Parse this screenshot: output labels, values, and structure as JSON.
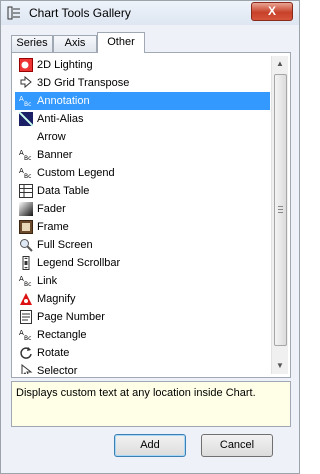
{
  "window": {
    "title": "Chart Tools Gallery",
    "close_label": "X"
  },
  "tabs": [
    {
      "label": "Series",
      "active": false
    },
    {
      "label": "Axis",
      "active": false
    },
    {
      "label": "Other",
      "active": true
    }
  ],
  "tools": [
    {
      "label": "2D Lighting",
      "icon": "2d-lighting-icon",
      "selected": false
    },
    {
      "label": "3D Grid Transpose",
      "icon": "3d-grid-transpose-icon",
      "selected": false
    },
    {
      "label": "Annotation",
      "icon": "text-abc-icon",
      "selected": true
    },
    {
      "label": "Anti-Alias",
      "icon": "anti-alias-icon",
      "selected": false
    },
    {
      "label": "Arrow",
      "icon": "arrow-icon",
      "selected": false
    },
    {
      "label": "Banner",
      "icon": "text-abc-icon",
      "selected": false
    },
    {
      "label": "Custom Legend",
      "icon": "text-abc-icon",
      "selected": false
    },
    {
      "label": "Data Table",
      "icon": "data-table-icon",
      "selected": false
    },
    {
      "label": "Fader",
      "icon": "fader-icon",
      "selected": false
    },
    {
      "label": "Frame",
      "icon": "frame-icon",
      "selected": false
    },
    {
      "label": "Full Screen",
      "icon": "magnifier-icon",
      "selected": false
    },
    {
      "label": "Legend Scrollbar",
      "icon": "legend-scrollbar-icon",
      "selected": false
    },
    {
      "label": "Link",
      "icon": "text-abc-icon",
      "selected": false
    },
    {
      "label": "Magnify",
      "icon": "magnify-icon",
      "selected": false
    },
    {
      "label": "Page Number",
      "icon": "page-number-icon",
      "selected": false
    },
    {
      "label": "Rectangle",
      "icon": "text-abc-icon",
      "selected": false
    },
    {
      "label": "Rotate",
      "icon": "rotate-icon",
      "selected": false
    },
    {
      "label": "Selector",
      "icon": "selector-icon",
      "selected": false
    }
  ],
  "description": "Displays custom text at any location inside Chart.",
  "buttons": {
    "add": "Add",
    "cancel": "Cancel"
  }
}
